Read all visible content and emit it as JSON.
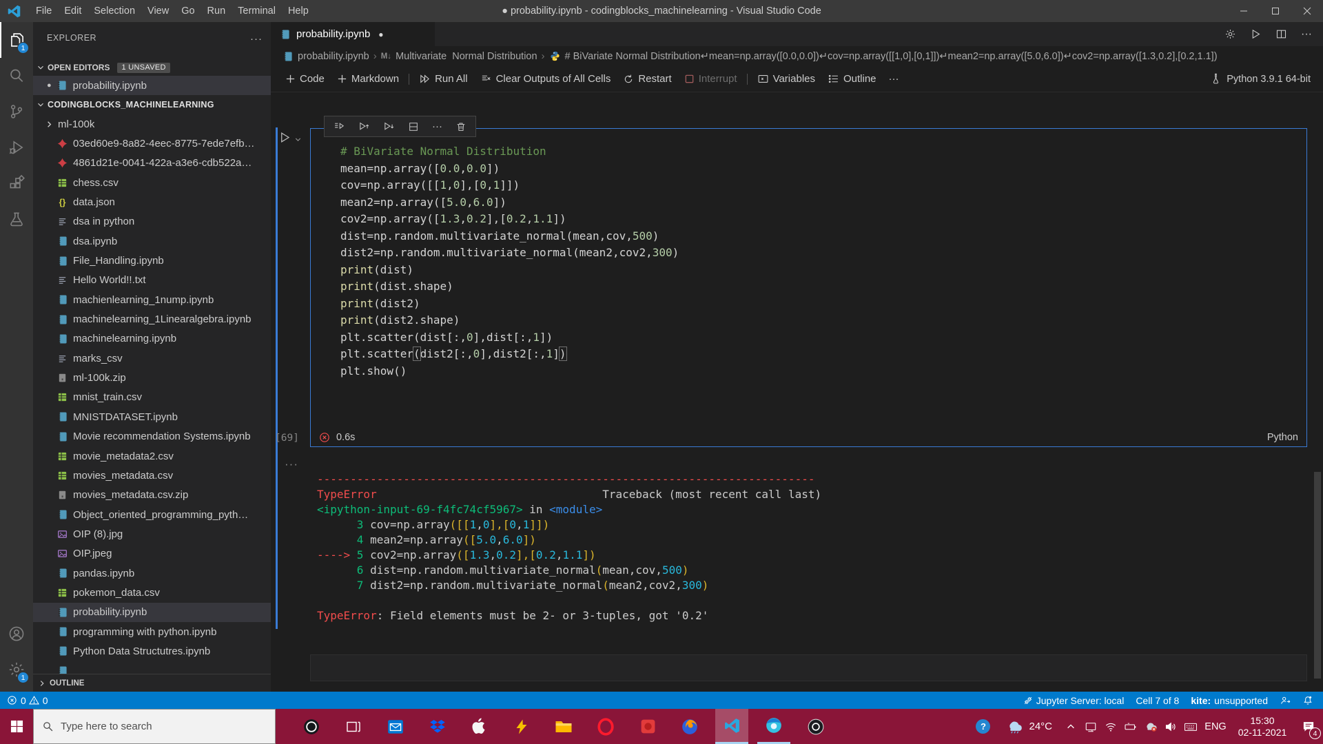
{
  "colors": {
    "accent": "#007acc",
    "taskbar": "#8a1538",
    "cell_border": "#3a7bd5",
    "error_red": "#f14c4c",
    "titlebar": "#3a3a3a",
    "sidebar_bg": "#252526",
    "editor_bg": "#1e1e1e"
  },
  "window": {
    "title": "● probability.ipynb - codingblocks_machinelearning - Visual Studio Code"
  },
  "menu": [
    "File",
    "Edit",
    "Selection",
    "View",
    "Go",
    "Run",
    "Terminal",
    "Help"
  ],
  "activity_bar": {
    "top": [
      {
        "name": "explorer",
        "badge": "1",
        "active": true
      },
      {
        "name": "search"
      },
      {
        "name": "source-control"
      },
      {
        "name": "run-debug"
      },
      {
        "name": "extensions"
      },
      {
        "name": "testing"
      }
    ],
    "bottom": [
      {
        "name": "accounts"
      },
      {
        "name": "settings",
        "badge": "1"
      }
    ]
  },
  "sidebar": {
    "title": "EXPLORER",
    "open_editors": {
      "label": "OPEN EDITORS",
      "badge": "1 UNSAVED",
      "items": [
        {
          "label": "probability.ipynb",
          "modified": true
        }
      ]
    },
    "workspace": "CODINGBLOCKS_MACHINELEARNING",
    "files": [
      {
        "label": "ml-100k",
        "icon": "folder"
      },
      {
        "label": "03ed60e9-8a82-4eec-8775-7ede7efb…",
        "icon": "pdf"
      },
      {
        "label": "4861d21e-0041-422a-a3e6-cdb522a…",
        "icon": "pdf"
      },
      {
        "label": "chess.csv",
        "icon": "csv"
      },
      {
        "label": "data.json",
        "icon": "json"
      },
      {
        "label": "dsa in python",
        "icon": "text"
      },
      {
        "label": "dsa.ipynb",
        "icon": "notebook"
      },
      {
        "label": "File_Handling.ipynb",
        "icon": "notebook"
      },
      {
        "label": "Hello World!!.txt",
        "icon": "text"
      },
      {
        "label": "machienlearning_1nump.ipynb",
        "icon": "notebook"
      },
      {
        "label": "machinelearning_1Linearalgebra.ipynb",
        "icon": "notebook"
      },
      {
        "label": "machinelearning.ipynb",
        "icon": "notebook"
      },
      {
        "label": "marks_csv",
        "icon": "text"
      },
      {
        "label": "ml-100k.zip",
        "icon": "zip"
      },
      {
        "label": "mnist_train.csv",
        "icon": "csv"
      },
      {
        "label": "MNISTDATASET.ipynb",
        "icon": "notebook"
      },
      {
        "label": "Movie recommendation Systems.ipynb",
        "icon": "notebook"
      },
      {
        "label": "movie_metadata2.csv",
        "icon": "csv"
      },
      {
        "label": "movies_metadata.csv",
        "icon": "csv"
      },
      {
        "label": "movies_metadata.csv.zip",
        "icon": "zip"
      },
      {
        "label": "Object_oriented_programming_pyth…",
        "icon": "notebook"
      },
      {
        "label": "OIP (8).jpg",
        "icon": "image"
      },
      {
        "label": "OIP.jpeg",
        "icon": "image"
      },
      {
        "label": "pandas.ipynb",
        "icon": "notebook"
      },
      {
        "label": "pokemon_data.csv",
        "icon": "csv"
      },
      {
        "label": "probability.ipynb",
        "icon": "notebook",
        "selected": true
      },
      {
        "label": "programming with python.ipynb",
        "icon": "notebook"
      },
      {
        "label": "Python Data Structutres.ipynb",
        "icon": "notebook"
      },
      {
        "label": "",
        "icon": "notebook",
        "clipped": true
      }
    ],
    "outline_label": "OUTLINE"
  },
  "editor": {
    "tab": {
      "label": "probability.ipynb",
      "modified": true
    },
    "breadcrumb": [
      {
        "label": "probability.ipynb",
        "icon": "notebook"
      },
      {
        "label": "Multivariate  Normal Distribution",
        "icon": "markdown"
      },
      {
        "label": "# BiVariate Normal Distribution↵mean=np.array([0.0,0.0])↵cov=np.array([[1,0],[0,1]])↵mean2=np.array([5.0,6.0])↵cov2=np.array([1.3,0.2],[0.2,1.1])",
        "icon": "python"
      }
    ],
    "toolbar": {
      "code": "Code",
      "markdown": "Markdown",
      "run_all": "Run All",
      "clear_outputs": "Clear Outputs of All Cells",
      "restart": "Restart",
      "interrupt": "Interrupt",
      "variables": "Variables",
      "outline": "Outline",
      "more": "···",
      "kernel": "Python 3.9.1 64-bit"
    },
    "cell": {
      "execution_count": "[69]",
      "duration": "0.6s",
      "language": "Python",
      "code_lines": [
        [
          [
            "# BiVariate Normal Distribution",
            "com"
          ]
        ],
        [
          [
            "mean=np.array([",
            "def"
          ],
          [
            "0.0",
            "num"
          ],
          [
            ",",
            "def"
          ],
          [
            "0.0",
            "num"
          ],
          [
            "])",
            "def"
          ]
        ],
        [
          [
            "cov=np.array([[",
            "def"
          ],
          [
            "1",
            "num"
          ],
          [
            ",",
            "def"
          ],
          [
            "0",
            "num"
          ],
          [
            "],[",
            "def"
          ],
          [
            "0",
            "num"
          ],
          [
            ",",
            "def"
          ],
          [
            "1",
            "num"
          ],
          [
            "]])",
            "def"
          ]
        ],
        [
          [
            "mean2=np.array([",
            "def"
          ],
          [
            "5.0",
            "num"
          ],
          [
            ",",
            "def"
          ],
          [
            "6.0",
            "num"
          ],
          [
            "])",
            "def"
          ]
        ],
        [
          [
            "cov2=np.array([",
            "def"
          ],
          [
            "1.3",
            "num"
          ],
          [
            ",",
            "def"
          ],
          [
            "0.2",
            "num"
          ],
          [
            "],[",
            "def"
          ],
          [
            "0.2",
            "num"
          ],
          [
            ",",
            "def"
          ],
          [
            "1.1",
            "num"
          ],
          [
            "])",
            "def"
          ]
        ],
        [
          [
            "dist=np.random.multivariate_normal(mean,cov,",
            "def"
          ],
          [
            "500",
            "num"
          ],
          [
            ")",
            "def"
          ]
        ],
        [
          [
            "dist2=np.random.multivariate_normal(mean2,cov2,",
            "def"
          ],
          [
            "300",
            "num"
          ],
          [
            ")",
            "def"
          ]
        ],
        [
          [
            "print",
            "fn"
          ],
          [
            "(dist)",
            "def"
          ]
        ],
        [
          [
            "print",
            "fn"
          ],
          [
            "(dist.shape)",
            "def"
          ]
        ],
        [
          [
            "print",
            "fn"
          ],
          [
            "(dist2)",
            "def"
          ]
        ],
        [
          [
            "print",
            "fn"
          ],
          [
            "(dist2.shape)",
            "def"
          ]
        ],
        [
          [
            "plt.scatter(dist[:,",
            "def"
          ],
          [
            "0",
            "num"
          ],
          [
            "],dist[:,",
            "def"
          ],
          [
            "1",
            "num"
          ],
          [
            "])",
            "def"
          ]
        ],
        [
          [
            "plt.scatter",
            "def"
          ],
          [
            "(",
            "brk"
          ],
          [
            "dist2[:,",
            "def"
          ],
          [
            "0",
            "num"
          ],
          [
            "],dist2[:,",
            "def"
          ],
          [
            "1",
            "num"
          ],
          [
            "]",
            "def"
          ],
          [
            ")",
            "brk"
          ]
        ],
        [
          [
            "plt.show()",
            "def"
          ]
        ]
      ]
    },
    "output_lines": [
      [
        [
          "---------------------------------------------------------------------------",
          "err"
        ]
      ],
      [
        [
          "TypeError",
          "err"
        ],
        [
          "                                  Traceback (most recent call last)",
          "out"
        ]
      ],
      [
        [
          "<ipython-input-69-f4fc74cf5967>",
          "grn"
        ],
        [
          " in ",
          "out"
        ],
        [
          "<module>",
          "blu"
        ]
      ],
      [
        [
          "      ",
          "out"
        ],
        [
          "3",
          "grn"
        ],
        [
          " cov=np.array",
          "out"
        ],
        [
          "([[",
          "yel"
        ],
        [
          "1",
          "cyn"
        ],
        [
          ",",
          "out"
        ],
        [
          "0",
          "cyn"
        ],
        [
          "],[",
          "yel"
        ],
        [
          "0",
          "cyn"
        ],
        [
          ",",
          "out"
        ],
        [
          "1",
          "cyn"
        ],
        [
          "]])",
          "yel"
        ]
      ],
      [
        [
          "      ",
          "out"
        ],
        [
          "4",
          "grn"
        ],
        [
          " mean2=np.array",
          "out"
        ],
        [
          "([",
          "yel"
        ],
        [
          "5.0",
          "cyn"
        ],
        [
          ",",
          "out"
        ],
        [
          "6.0",
          "cyn"
        ],
        [
          "])",
          "yel"
        ]
      ],
      [
        [
          "----> ",
          "err"
        ],
        [
          "5",
          "grn"
        ],
        [
          " cov2=np.array",
          "out"
        ],
        [
          "([",
          "yel"
        ],
        [
          "1.3",
          "cyn"
        ],
        [
          ",",
          "out"
        ],
        [
          "0.2",
          "cyn"
        ],
        [
          "],[",
          "yel"
        ],
        [
          "0.2",
          "cyn"
        ],
        [
          ",",
          "out"
        ],
        [
          "1.1",
          "cyn"
        ],
        [
          "])",
          "yel"
        ]
      ],
      [
        [
          "      ",
          "out"
        ],
        [
          "6",
          "grn"
        ],
        [
          " dist=np.random.multivariate_normal",
          "out"
        ],
        [
          "(",
          "yel"
        ],
        [
          "mean,cov,",
          "out"
        ],
        [
          "500",
          "cyn"
        ],
        [
          ")",
          "yel"
        ]
      ],
      [
        [
          "      ",
          "out"
        ],
        [
          "7",
          "grn"
        ],
        [
          " dist2=np.random.multivariate_normal",
          "out"
        ],
        [
          "(",
          "yel"
        ],
        [
          "mean2,cov2,",
          "out"
        ],
        [
          "300",
          "cyn"
        ],
        [
          ")",
          "yel"
        ]
      ],
      [
        [
          "",
          "out"
        ]
      ],
      [
        [
          "TypeError",
          "err"
        ],
        [
          ": Field elements must be 2- or 3-tuples, got '0.2'",
          "out"
        ]
      ]
    ]
  },
  "status_bar": {
    "errors": "0",
    "warnings": "0",
    "jupyter": "Jupyter Server: local",
    "cell_position": "Cell 7 of 8",
    "kite_label": "kite:",
    "kite_value": " unsupported"
  },
  "taskbar": {
    "search_placeholder": "Type here to search",
    "apps": [
      "cortana",
      "task-view",
      "mail",
      "dropbox",
      "apple",
      "lightning",
      "file-explorer",
      "opera",
      "red-app",
      "firefox",
      "vscode",
      "chrome",
      "obs"
    ],
    "active_app": "vscode",
    "open_apps": [
      "vscode",
      "chrome"
    ],
    "tray": {
      "help": "?",
      "temperature": "24°C",
      "language": "ENG",
      "time": "15:30",
      "date": "02-11-2021",
      "notification_count": "4"
    }
  }
}
